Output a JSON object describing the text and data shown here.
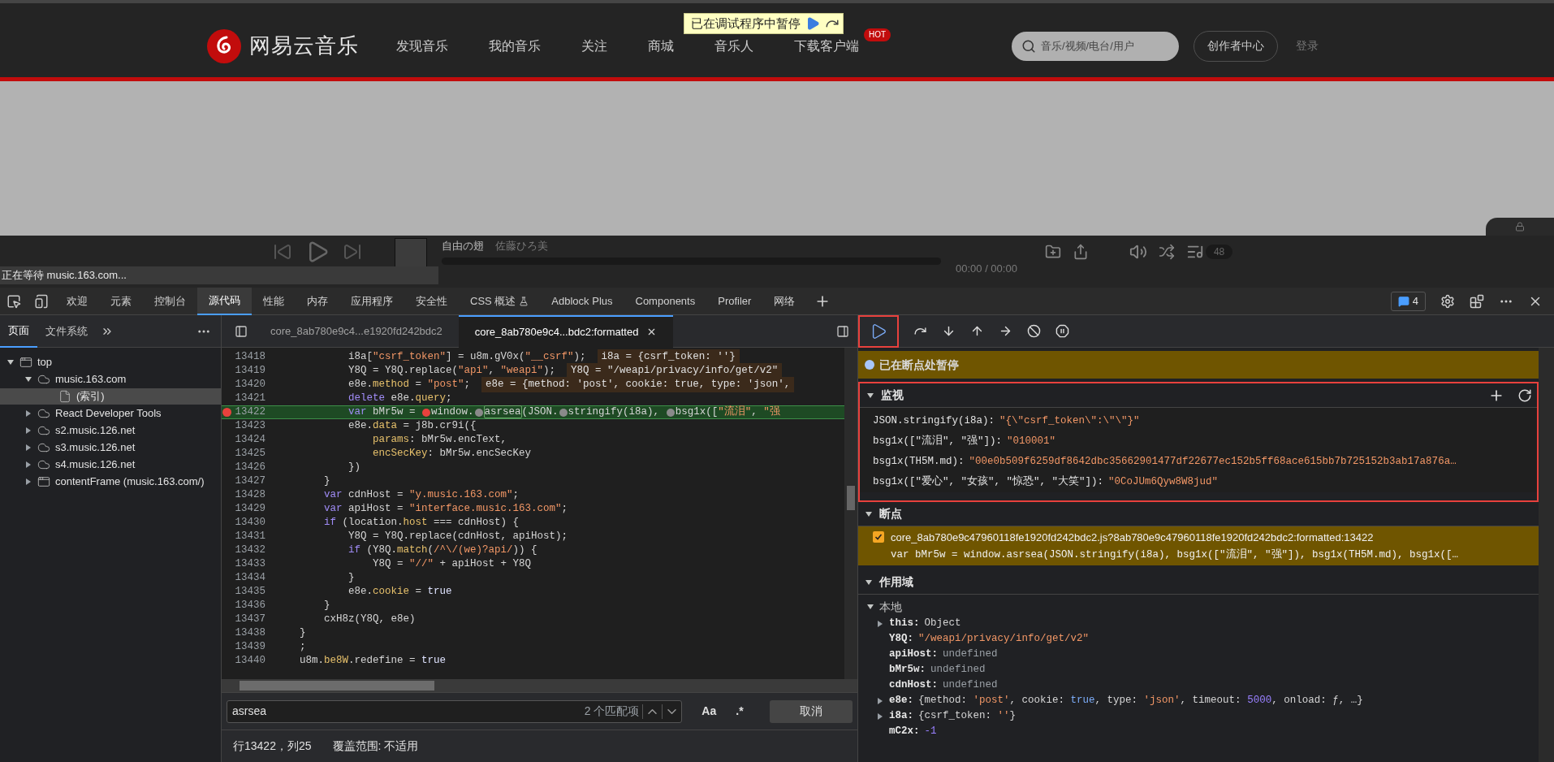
{
  "site_header": {
    "logo": "网易云音乐",
    "nav": [
      {
        "label": "发现音乐"
      },
      {
        "label": "我的音乐"
      },
      {
        "label": "关注"
      },
      {
        "label": "商城"
      },
      {
        "label": "音乐人"
      },
      {
        "label": "下载客户端",
        "badge": "HOT"
      }
    ],
    "search": {
      "placeholder": "音乐/视频/电台/用户"
    },
    "creator_button": "创作者中心",
    "login": "登录"
  },
  "debug_banner": {
    "text": "已在调试程序中暂停"
  },
  "player": {
    "track": "自由の翅",
    "artist": "佐藤ひろ美",
    "time": "00:00 / 00:00",
    "playlist_count": "48"
  },
  "loading_status": "正在等待 music.163.com...",
  "devtools": {
    "tabs": [
      {
        "label": "欢迎",
        "kind": "text",
        "selected": false
      },
      {
        "label": "元素",
        "kind": "text",
        "selected": false
      },
      {
        "label": "控制台",
        "kind": "text",
        "selected": false
      },
      {
        "label": "源代码",
        "kind": "text",
        "selected": true
      },
      {
        "label": "性能",
        "kind": "text",
        "selected": false
      },
      {
        "label": "内存",
        "kind": "text",
        "selected": false
      },
      {
        "label": "应用程序",
        "kind": "text",
        "selected": false
      },
      {
        "label": "安全性",
        "kind": "text",
        "selected": false
      },
      {
        "label": "CSS 概述",
        "kind": "experimental",
        "selected": false
      },
      {
        "label": "Adblock Plus",
        "kind": "text",
        "selected": false
      },
      {
        "label": "Components",
        "kind": "text",
        "selected": false
      },
      {
        "label": "Profiler",
        "kind": "text",
        "selected": false
      },
      {
        "label": "网络",
        "kind": "text",
        "selected": false
      }
    ],
    "issues_count": "4"
  },
  "navigator": {
    "tabs": [
      {
        "label": "页面",
        "selected": true
      },
      {
        "label": "文件系统",
        "selected": false
      }
    ],
    "tree": [
      {
        "label": "top",
        "kind": "frame",
        "expanded": true,
        "selected": false,
        "children": [
          {
            "label": "music.163.com",
            "kind": "domain",
            "expanded": true,
            "selected": false,
            "children": [
              {
                "label": "(索引)",
                "kind": "file",
                "selected": true
              }
            ]
          },
          {
            "label": "React Developer Tools",
            "kind": "domain",
            "expanded": false,
            "selected": false
          },
          {
            "label": "s2.music.126.net",
            "kind": "domain",
            "expanded": false,
            "selected": false
          },
          {
            "label": "s3.music.126.net",
            "kind": "domain",
            "expanded": false,
            "selected": false
          },
          {
            "label": "s4.music.126.net",
            "kind": "domain",
            "expanded": false,
            "selected": false
          },
          {
            "label": "contentFrame (music.163.com/)",
            "kind": "frame",
            "expanded": false,
            "selected": false
          }
        ]
      }
    ]
  },
  "editor_tabs": [
    {
      "label": "core_8ab780e9c4...e1920fd242bdc2",
      "selected": false
    },
    {
      "label": "core_8ab780e9c4...bdc2:formatted",
      "selected": true
    }
  ],
  "code": {
    "lines": [
      {
        "n": "13418",
        "breakpoint": false,
        "current": false,
        "tokens": [
          {
            "t": "            i8a[",
            "kind": "plain"
          },
          {
            "t": "\"csrf_token\"",
            "kind": "str"
          },
          {
            "t": "] = u8m.gV0x(",
            "kind": "plain"
          },
          {
            "t": "\"__csrf\"",
            "kind": "str"
          },
          {
            "t": ");",
            "kind": "plain"
          }
        ],
        "inline": "i8a = {csrf_token: ''}"
      },
      {
        "n": "13419",
        "breakpoint": false,
        "current": false,
        "tokens": [
          {
            "t": "            Y8Q = Y8Q.replace(",
            "kind": "plain"
          },
          {
            "t": "\"api\"",
            "kind": "str"
          },
          {
            "t": ", ",
            "kind": "plain"
          },
          {
            "t": "\"weapi\"",
            "kind": "str"
          },
          {
            "t": ");",
            "kind": "plain"
          }
        ],
        "inline": "Y8Q = \"/weapi/privacy/info/get/v2\""
      },
      {
        "n": "13420",
        "breakpoint": false,
        "current": false,
        "tokens": [
          {
            "t": "            e8e.",
            "kind": "plain"
          },
          {
            "t": "method",
            "kind": "prop"
          },
          {
            "t": " = ",
            "kind": "plain"
          },
          {
            "t": "\"post\"",
            "kind": "str"
          },
          {
            "t": ";",
            "kind": "plain"
          }
        ],
        "inline": "e8e = {method: 'post', cookie: true, type: 'json',"
      },
      {
        "n": "13421",
        "breakpoint": false,
        "current": false,
        "tokens": [
          {
            "t": "            delete",
            "kind": "kw"
          },
          {
            "t": " e8e.",
            "kind": "plain"
          },
          {
            "t": "query",
            "kind": "prop"
          },
          {
            "t": ";",
            "kind": "plain"
          }
        ]
      },
      {
        "n": "13422",
        "breakpoint": true,
        "current": true,
        "tokens": [
          {
            "t": "            var",
            "kind": "kw"
          },
          {
            "t": " bMr5w = ",
            "kind": "plain"
          },
          {
            "kind": "marker",
            "active": true
          },
          {
            "t": "window.",
            "kind": "plain"
          },
          {
            "kind": "marker",
            "active": false
          },
          {
            "t": "asrsea",
            "kind": "match"
          },
          {
            "t": "(JSON.",
            "kind": "plain"
          },
          {
            "kind": "marker",
            "active": false
          },
          {
            "t": "stringify(i8a), ",
            "kind": "plain"
          },
          {
            "kind": "marker",
            "active": false
          },
          {
            "t": "bsg1x([",
            "kind": "plain"
          },
          {
            "t": "\"流泪\"",
            "kind": "str"
          },
          {
            "t": ", ",
            "kind": "plain"
          },
          {
            "t": "\"强",
            "kind": "str"
          }
        ]
      },
      {
        "n": "13423",
        "breakpoint": false,
        "current": false,
        "tokens": [
          {
            "t": "            e8e.",
            "kind": "plain"
          },
          {
            "t": "data",
            "kind": "prop"
          },
          {
            "t": " = j8b.cr9i({",
            "kind": "plain"
          }
        ]
      },
      {
        "n": "13424",
        "breakpoint": false,
        "current": false,
        "tokens": [
          {
            "t": "                params",
            "kind": "prop"
          },
          {
            "t": ": bMr5w.encText,",
            "kind": "plain"
          }
        ]
      },
      {
        "n": "13425",
        "breakpoint": false,
        "current": false,
        "tokens": [
          {
            "t": "                encSecKey",
            "kind": "prop"
          },
          {
            "t": ": bMr5w.encSecKey",
            "kind": "plain"
          }
        ]
      },
      {
        "n": "13426",
        "breakpoint": false,
        "current": false,
        "tokens": [
          {
            "t": "            })",
            "kind": "plain"
          }
        ]
      },
      {
        "n": "13427",
        "breakpoint": false,
        "current": false,
        "tokens": [
          {
            "t": "        }",
            "kind": "plain"
          }
        ]
      },
      {
        "n": "13428",
        "breakpoint": false,
        "current": false,
        "tokens": [
          {
            "t": "        var",
            "kind": "kw"
          },
          {
            "t": " cdnHost = ",
            "kind": "plain"
          },
          {
            "t": "\"y.music.163.com\"",
            "kind": "str"
          },
          {
            "t": ";",
            "kind": "plain"
          }
        ]
      },
      {
        "n": "13429",
        "breakpoint": false,
        "current": false,
        "tokens": [
          {
            "t": "        var",
            "kind": "kw"
          },
          {
            "t": " apiHost = ",
            "kind": "plain"
          },
          {
            "t": "\"interface.music.163.com\"",
            "kind": "str"
          },
          {
            "t": ";",
            "kind": "plain"
          }
        ]
      },
      {
        "n": "13430",
        "breakpoint": false,
        "current": false,
        "tokens": [
          {
            "t": "        if",
            "kind": "kw"
          },
          {
            "t": " (location.",
            "kind": "plain"
          },
          {
            "t": "host",
            "kind": "prop"
          },
          {
            "t": " === cdnHost) {",
            "kind": "plain"
          }
        ]
      },
      {
        "n": "13431",
        "breakpoint": false,
        "current": false,
        "tokens": [
          {
            "t": "            Y8Q = Y8Q.replace(cdnHost, apiHost);",
            "kind": "plain"
          }
        ]
      },
      {
        "n": "13432",
        "breakpoint": false,
        "current": false,
        "tokens": [
          {
            "t": "            if",
            "kind": "kw"
          },
          {
            "t": " (Y8Q.",
            "kind": "plain"
          },
          {
            "t": "match",
            "kind": "prop"
          },
          {
            "t": "(",
            "kind": "plain"
          },
          {
            "t": "/^\\/(we)?api/",
            "kind": "str"
          },
          {
            "t": ")) {",
            "kind": "plain"
          }
        ]
      },
      {
        "n": "13433",
        "breakpoint": false,
        "current": false,
        "tokens": [
          {
            "t": "                Y8Q = ",
            "kind": "plain"
          },
          {
            "t": "\"//\"",
            "kind": "str"
          },
          {
            "t": " + apiHost + Y8Q",
            "kind": "plain"
          }
        ]
      },
      {
        "n": "13434",
        "breakpoint": false,
        "current": false,
        "tokens": [
          {
            "t": "            }",
            "kind": "plain"
          }
        ]
      },
      {
        "n": "13435",
        "breakpoint": false,
        "current": false,
        "tokens": [
          {
            "t": "            e8e.",
            "kind": "plain"
          },
          {
            "t": "cookie",
            "kind": "prop"
          },
          {
            "t": " = ",
            "kind": "plain"
          },
          {
            "t": "true",
            "kind": "lit"
          }
        ]
      },
      {
        "n": "13436",
        "breakpoint": false,
        "current": false,
        "tokens": [
          {
            "t": "        }",
            "kind": "plain"
          }
        ]
      },
      {
        "n": "13437",
        "breakpoint": false,
        "current": false,
        "tokens": [
          {
            "t": "        cxH8z(Y8Q, e8e)",
            "kind": "plain"
          }
        ]
      },
      {
        "n": "13438",
        "breakpoint": false,
        "current": false,
        "tokens": [
          {
            "t": "    }",
            "kind": "plain"
          }
        ]
      },
      {
        "n": "13439",
        "breakpoint": false,
        "current": false,
        "tokens": [
          {
            "t": "    ;",
            "kind": "plain"
          }
        ]
      },
      {
        "n": "13440",
        "breakpoint": false,
        "current": false,
        "tokens": [
          {
            "t": "    u8m.",
            "kind": "plain"
          },
          {
            "t": "be8W",
            "kind": "prop"
          },
          {
            "t": ".redefine = ",
            "kind": "plain"
          },
          {
            "t": "true",
            "kind": "lit"
          }
        ]
      }
    ]
  },
  "search": {
    "value": "asrsea",
    "match_count": "2 个匹配项",
    "case_label": "Aa",
    "regex_label": ".*",
    "cancel": "取消"
  },
  "status": {
    "position": "行13422，列25",
    "coverage": "覆盖范围: 不适用"
  },
  "debugger": {
    "paused_message": "已在断点处暂停",
    "watch": {
      "title": "监视",
      "expanded": true,
      "items": [
        {
          "expr": "JSON.stringify(i8a):",
          "value": "\"{\\\"csrf_token\\\":\\\"\\\"}\""
        },
        {
          "expr": "bsg1x([\"流泪\", \"强\"]):",
          "value": "\"010001\""
        },
        {
          "expr": "bsg1x(TH5M.md):",
          "value": "\"00e0b509f6259df8642dbc35662901477df22677ec152b5ff68ace615bb7b725152b3ab17a876a…"
        },
        {
          "expr": "bsg1x([\"爱心\", \"女孩\", \"惊恐\", \"大笑\"]):",
          "value": "\"0CoJUm6Qyw8W8jud\""
        }
      ]
    },
    "breakpoints": {
      "title": "断点",
      "expanded": true,
      "items": [
        {
          "checked": true,
          "location": "core_8ab780e9c47960118fe1920fd242bdc2.js?8ab780e9c47960118fe1920fd242bdc2:formatted:13422",
          "code": "var bMr5w = window.asrsea(JSON.stringify(i8a), bsg1x([\"流泪\", \"强\"]), bsg1x(TH5M.md), bsg1x([…"
        }
      ]
    },
    "scope": {
      "title": "作用域",
      "expanded": true,
      "groups": [
        {
          "label": "本地",
          "expanded": true,
          "items": [
            {
              "name": "this:",
              "expandable": true,
              "value": [
                {
                  "t": "Object",
                  "kind": "plain"
                }
              ]
            },
            {
              "name": "Y8Q:",
              "expandable": false,
              "value": [
                {
                  "t": "\"/weapi/privacy/info/get/v2\"",
                  "kind": "str"
                }
              ]
            },
            {
              "name": "apiHost:",
              "expandable": false,
              "value": [
                {
                  "t": "undefined",
                  "kind": "undef"
                }
              ]
            },
            {
              "name": "bMr5w:",
              "expandable": false,
              "value": [
                {
                  "t": "undefined",
                  "kind": "undef"
                }
              ]
            },
            {
              "name": "cdnHost:",
              "expandable": false,
              "value": [
                {
                  "t": "undefined",
                  "kind": "undef"
                }
              ]
            },
            {
              "name": "e8e:",
              "expandable": true,
              "value": [
                {
                  "t": "{method: ",
                  "kind": "plain"
                },
                {
                  "t": "'post'",
                  "kind": "str"
                },
                {
                  "t": ", cookie: ",
                  "kind": "plain"
                },
                {
                  "t": "true",
                  "kind": "bool"
                },
                {
                  "t": ", type: ",
                  "kind": "plain"
                },
                {
                  "t": "'json'",
                  "kind": "str"
                },
                {
                  "t": ", timeout: ",
                  "kind": "plain"
                },
                {
                  "t": "5000",
                  "kind": "num"
                },
                {
                  "t": ", onload: ƒ, …}",
                  "kind": "plain"
                }
              ]
            },
            {
              "name": "i8a:",
              "expandable": true,
              "value": [
                {
                  "t": "{csrf_token: ",
                  "kind": "plain"
                },
                {
                  "t": "''",
                  "kind": "str"
                },
                {
                  "t": "}",
                  "kind": "plain"
                }
              ]
            },
            {
              "name": "mC2x:",
              "expandable": false,
              "value": [
                {
                  "t": "-1",
                  "kind": "num"
                }
              ]
            }
          ]
        }
      ]
    }
  }
}
